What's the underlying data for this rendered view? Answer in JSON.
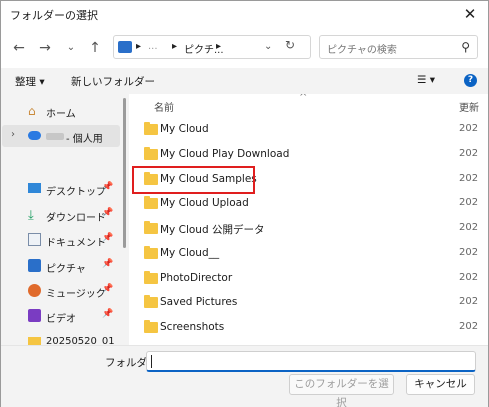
{
  "window": {
    "title": "フォルダーの選択"
  },
  "address": {
    "segments": [
      "▸",
      "...",
      "▸",
      "ピクチ...",
      "▸"
    ]
  },
  "search": {
    "placeholder": "ピクチャの検索"
  },
  "toolbar": {
    "organize": "整理",
    "new_folder": "新しいフォルダー",
    "help": "?"
  },
  "sidebar": {
    "items": [
      {
        "label": "ホーム"
      },
      {
        "label": "- 個人用"
      },
      {
        "label": "デスクトップ"
      },
      {
        "label": "ダウンロード"
      },
      {
        "label": "ドキュメント"
      },
      {
        "label": "ピクチャ"
      },
      {
        "label": "ミュージック"
      },
      {
        "label": "ビデオ"
      },
      {
        "label": "20250520_01"
      }
    ]
  },
  "columns": {
    "name": "名前",
    "date": "更新"
  },
  "files": [
    {
      "name": "My Cloud",
      "date": "202"
    },
    {
      "name": "My Cloud Play Download",
      "date": "202"
    },
    {
      "name": "My Cloud Samples",
      "date": "202"
    },
    {
      "name": "My Cloud Upload",
      "date": "202"
    },
    {
      "name": "My Cloud 公開データ",
      "date": "202"
    },
    {
      "name": "My Cloud__",
      "date": "202"
    },
    {
      "name": "PhotoDirector",
      "date": "202"
    },
    {
      "name": "Saved Pictures",
      "date": "202"
    },
    {
      "name": "Screenshots",
      "date": "202"
    }
  ],
  "bottom": {
    "folder_label": "フォルダー:",
    "folder_value": "",
    "select_button": "このフォルダーを選択",
    "cancel_button": "キャンセル"
  }
}
